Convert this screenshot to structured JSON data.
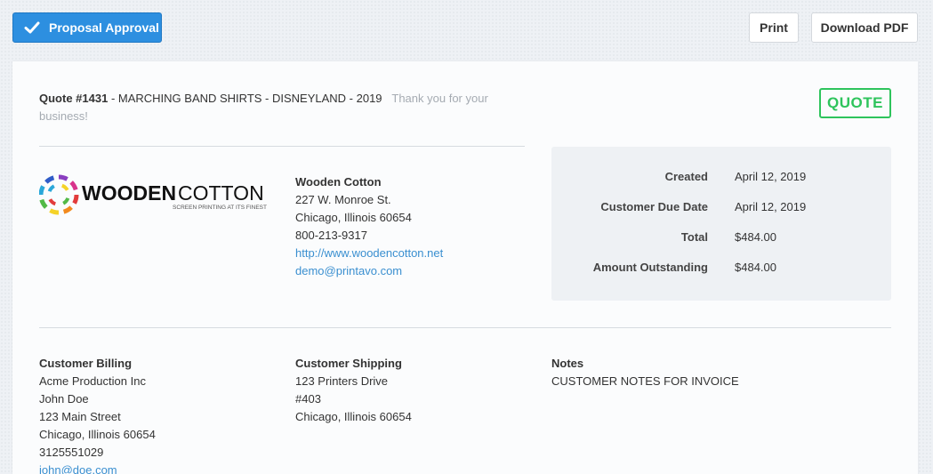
{
  "toolbar": {
    "approve_label": "Proposal Approval",
    "print_label": "Print",
    "pdf_label": "Download PDF"
  },
  "quote": {
    "number": "Quote #1431",
    "title": " - MARCHING BAND SHIRTS - DISNEYLAND - 2019",
    "thanks": "Thank you for your business!",
    "badge": "QUOTE"
  },
  "company": {
    "logo_word_a": "WOODEN",
    "logo_word_b": "COTTON",
    "logo_tagline": "SCREEN PRINTING AT ITS FINEST",
    "name": "Wooden Cotton",
    "street": "227 W. Monroe St.",
    "city": "Chicago, Illinois 60654",
    "phone": "800-213-9317",
    "website": "http://www.woodencotton.net",
    "email": "demo@printavo.com"
  },
  "summary": {
    "rows": [
      {
        "label": "Created",
        "value": "April 12, 2019"
      },
      {
        "label": "Customer Due Date",
        "value": "April 12, 2019"
      },
      {
        "label": "Total",
        "value": "$484.00"
      },
      {
        "label": "Amount Outstanding",
        "value": "$484.00"
      }
    ]
  },
  "billing": {
    "heading": "Customer Billing",
    "company": "Acme Production Inc",
    "contact": "John Doe",
    "street": "123 Main Street",
    "city": "Chicago, Illinois 60654",
    "phone": "3125551029",
    "email": "john@doe.com"
  },
  "shipping": {
    "heading": "Customer Shipping",
    "street": "123 Printers Drive",
    "unit": "#403",
    "city": "Chicago, Illinois 60654"
  },
  "notes": {
    "heading": "Notes",
    "text": "CUSTOMER NOTES FOR INVOICE"
  },
  "colors": {
    "primary": "#2d8fe0",
    "quote_badge": "#2ec45c",
    "link": "#3a8fd0"
  },
  "icons": {
    "approve": "checkmark-icon"
  }
}
